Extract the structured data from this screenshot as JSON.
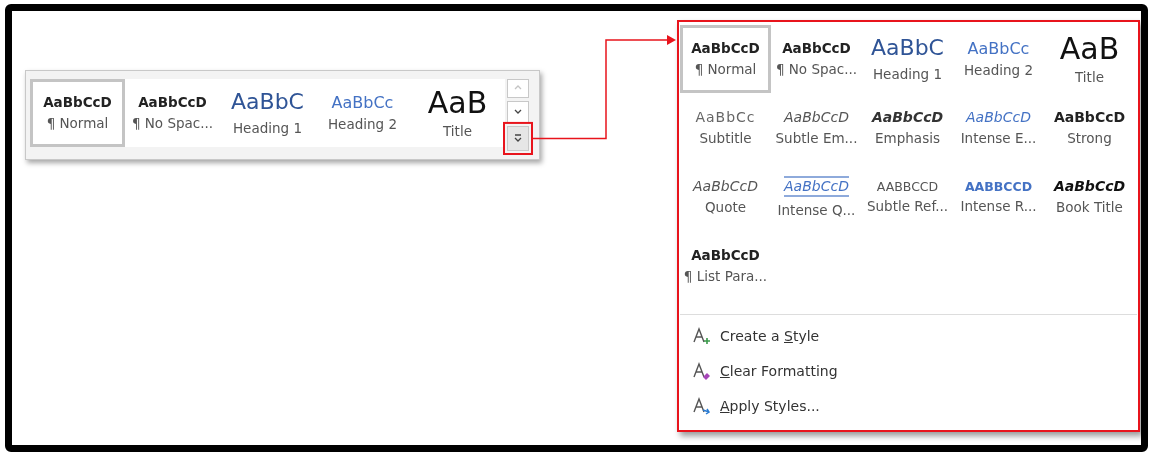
{
  "ribbon_gallery": {
    "styles": [
      {
        "preview": "AaBbCcD",
        "label": "¶ Normal",
        "kind": "normal",
        "selected": true
      },
      {
        "preview": "AaBbCcD",
        "label": "¶ No Spac...",
        "kind": "no_spacing",
        "selected": false
      },
      {
        "preview": "AaBbC",
        "label": "Heading 1",
        "kind": "heading1",
        "selected": false
      },
      {
        "preview": "AaBbCc",
        "label": "Heading 2",
        "kind": "heading2",
        "selected": false
      },
      {
        "preview": "AaB",
        "label": "Title",
        "kind": "title",
        "selected": false
      }
    ],
    "scroll_buttons": [
      {
        "kind": "up",
        "disabled": true
      },
      {
        "kind": "down",
        "disabled": false
      },
      {
        "kind": "more",
        "disabled": false
      }
    ]
  },
  "expanded_gallery": {
    "styles": [
      {
        "preview": "AaBbCcD",
        "label": "¶ Normal",
        "kind": "normal",
        "selected": true
      },
      {
        "preview": "AaBbCcD",
        "label": "¶ No Spac...",
        "kind": "no_spacing",
        "selected": false
      },
      {
        "preview": "AaBbC",
        "label": "Heading 1",
        "kind": "heading1",
        "selected": false
      },
      {
        "preview": "AaBbCc",
        "label": "Heading 2",
        "kind": "heading2",
        "selected": false
      },
      {
        "preview": "AaB",
        "label": "Title",
        "kind": "title",
        "selected": false
      },
      {
        "preview": "AaBbCc",
        "label": "Subtitle",
        "kind": "subtitle",
        "selected": false
      },
      {
        "preview": "AaBbCcD",
        "label": "Subtle Em...",
        "kind": "subtle_emphasis",
        "selected": false
      },
      {
        "preview": "AaBbCcD",
        "label": "Emphasis",
        "kind": "emphasis",
        "selected": false
      },
      {
        "preview": "AaBbCcD",
        "label": "Intense E...",
        "kind": "intense_emphasis",
        "selected": false
      },
      {
        "preview": "AaBbCcD",
        "label": "Strong",
        "kind": "strong",
        "selected": false
      },
      {
        "preview": "AaBbCcD",
        "label": "Quote",
        "kind": "quote",
        "selected": false
      },
      {
        "preview": "AaBbCcD",
        "label": "Intense Q...",
        "kind": "intense_quote",
        "selected": false
      },
      {
        "preview": "AABBCCD",
        "label": "Subtle Ref...",
        "kind": "subtle_reference",
        "selected": false
      },
      {
        "preview": "AABBCCD",
        "label": "Intense R...",
        "kind": "intense_reference",
        "selected": false
      },
      {
        "preview": "AaBbCcD",
        "label": "Book Title",
        "kind": "book_title",
        "selected": false
      },
      {
        "preview": "AaBbCcD",
        "label": "¶ List Para...",
        "kind": "list_paragraph",
        "selected": false
      }
    ],
    "commands": [
      {
        "kind": "create",
        "parts": [
          {
            "text": "Create a ",
            "underlined": false
          },
          {
            "text": "S",
            "underlined": true
          },
          {
            "text": "tyle",
            "underlined": false
          }
        ]
      },
      {
        "kind": "clear",
        "parts": [
          {
            "text": "C",
            "underlined": true
          },
          {
            "text": "lear Formatting",
            "underlined": false
          }
        ]
      },
      {
        "kind": "apply",
        "parts": [
          {
            "text": "A",
            "underlined": true
          },
          {
            "text": "pply Styles...",
            "underlined": false
          }
        ]
      }
    ]
  }
}
